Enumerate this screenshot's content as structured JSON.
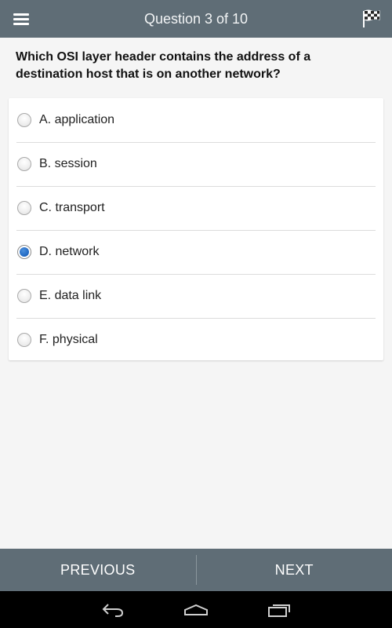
{
  "header": {
    "title": "Question 3 of 10",
    "menu_icon": "hamburger-menu-icon",
    "finish_icon": "checkered-flag-icon"
  },
  "question": {
    "text": "Which OSI layer header contains the address of a destination host that is on another network?"
  },
  "options": [
    {
      "label": "A. application",
      "selected": false
    },
    {
      "label": "B. session",
      "selected": false
    },
    {
      "label": "C. transport",
      "selected": false
    },
    {
      "label": "D. network",
      "selected": true
    },
    {
      "label": "E. data link",
      "selected": false
    },
    {
      "label": "F. physical",
      "selected": false
    }
  ],
  "navigation": {
    "previous_label": "PREVIOUS",
    "next_label": "NEXT"
  },
  "system_bar": {
    "back_icon": "back-icon",
    "home_icon": "home-icon",
    "recents_icon": "recent-apps-icon"
  },
  "colors": {
    "bar": "#5f6d76",
    "background": "#f5f5f5",
    "selected_radio": "#1f66c0"
  }
}
